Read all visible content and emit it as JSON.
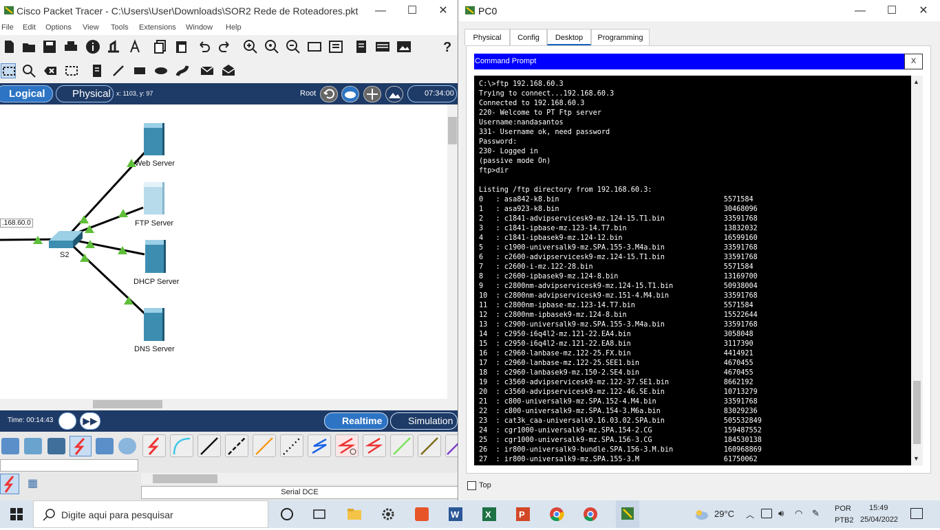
{
  "packet_tracer": {
    "title": "Cisco Packet Tracer - C:\\Users\\User\\Downloads\\SOR2 Rede de Roteadores.pkt",
    "menu": [
      "File",
      "Edit",
      "Options",
      "View",
      "Tools",
      "Extensions",
      "Window",
      "Help"
    ],
    "nav": {
      "logical": "Logical",
      "physical": "Physical",
      "coords": "x: 1103, y: 97",
      "root": "Root",
      "clock": "07:34:00"
    },
    "devices": {
      "web_server": "Web Server",
      "ftp_server": "FTP Server",
      "dhcp_server": "DHCP Server",
      "dns_server": "DNS Server",
      "switch": "S2",
      "network": ".168.60.0"
    },
    "status": {
      "time": "Time: 00:14:43",
      "realtime": "Realtime",
      "simulation": "Simulation"
    },
    "cable_name": "Serial DCE"
  },
  "pc0": {
    "title": "PC0",
    "tabs": [
      "Physical",
      "Config",
      "Desktop",
      "Programming"
    ],
    "active_tab": "Desktop",
    "cmd_title": "Command Prompt",
    "cmd_close": "X",
    "terminal_lines": [
      "C:\\>ftp 192.168.60.3",
      "Trying to connect...192.168.60.3",
      "Connected to 192.168.60.3",
      "220- Welcome to PT Ftp server",
      "Username:nandasantos",
      "331- Username ok, need password",
      "Password:",
      "230- Logged in",
      "(passive mode On)",
      "ftp>dir",
      "",
      "Listing /ftp directory from 192.168.60.3:",
      "0   : asa842-k8.bin                                       5571584",
      "1   : asa923-k8.bin                                       30468096",
      "2   : c1841-advipservicesk9-mz.124-15.T1.bin              33591768",
      "3   : c1841-ipbase-mz.123-14.T7.bin                       13832032",
      "4   : c1841-ipbasek9-mz.124-12.bin                        16599160",
      "5   : c1900-universalk9-mz.SPA.155-3.M4a.bin              33591768",
      "6   : c2600-advipservicesk9-mz.124-15.T1.bin              33591768",
      "7   : c2600-i-mz.122-28.bin                               5571584",
      "8   : c2600-ipbasek9-mz.124-8.bin                         13169700",
      "9   : c2800nm-advipservicesk9-mz.124-15.T1.bin            50938004",
      "10  : c2800nm-advipservicesk9-mz.151-4.M4.bin             33591768",
      "11  : c2800nm-ipbase-mz.123-14.T7.bin                     5571584",
      "12  : c2800nm-ipbasek9-mz.124-8.bin                       15522644",
      "13  : c2900-universalk9-mz.SPA.155-3.M4a.bin              33591768",
      "14  : c2950-i6q4l2-mz.121-22.EA4.bin                      3058048",
      "15  : c2950-i6q4l2-mz.121-22.EA8.bin                      3117390",
      "16  : c2960-lanbase-mz.122-25.FX.bin                      4414921",
      "17  : c2960-lanbase-mz.122-25.SEE1.bin                    4670455",
      "18  : c2960-lanbasek9-mz.150-2.SE4.bin                    4670455",
      "19  : c3560-advipservicesk9-mz.122-37.SE1.bin             8662192",
      "20  : c3560-advipservicesk9-mz.122-46.SE.bin              10713279",
      "21  : c800-universalk9-mz.SPA.152-4.M4.bin                33591768",
      "22  : c800-universalk9-mz.SPA.154-3.M6a.bin               83029236",
      "23  : cat3k_caa-universalk9.16.03.02.SPA.bin              505532849",
      "24  : cgr1000-universalk9-mz.SPA.154-2.CG                 159487552",
      "25  : cgr1000-universalk9-mz.SPA.156-3.CG                 184530138",
      "26  : ir800-universalk9-bundle.SPA.156-3.M.bin            160968869",
      "27  : ir800-universalk9-mz.SPA.155-3.M                    61750062"
    ],
    "top_label": "Top"
  },
  "taskbar": {
    "search_placeholder": "Digite aqui para pesquisar",
    "weather": "29°C",
    "lang1": "POR",
    "lang2": "PTB2",
    "time": "15:49",
    "date": "25/04/2022"
  },
  "colors": {
    "pt_nav": "#1e3a66",
    "pt_accent": "#2d74c4",
    "cmd_title": "#0000ff",
    "link_green": "#5fbf3a",
    "server_blue": "#3d8db0"
  }
}
